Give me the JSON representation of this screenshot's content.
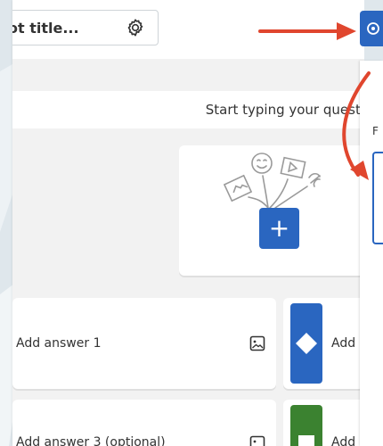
{
  "header": {
    "title_fragment": "ot title...",
    "settings_icon": "gear-icon"
  },
  "question": {
    "placeholder": "Start typing your questi"
  },
  "media": {
    "add_label": "+",
    "illustration_icon": "media-illustration-icon"
  },
  "answers": [
    {
      "label": "Add answer 1",
      "side_label": "Add",
      "shape": "diamond",
      "color": "#2a66c0"
    },
    {
      "label": "Add answer 3 (optional)",
      "side_label": "Add",
      "shape": "square",
      "color": "#3b8230"
    }
  ],
  "panel": {
    "letter": "F"
  },
  "colors": {
    "accent_blue": "#2a66c0",
    "arrow_red": "#e0462e",
    "answer_green": "#3b8230"
  }
}
